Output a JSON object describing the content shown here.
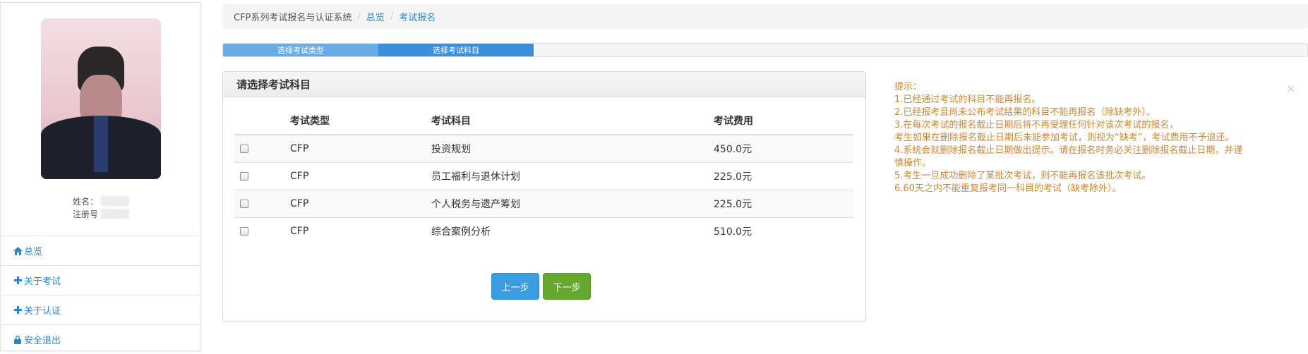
{
  "sidebar": {
    "name_label": "姓名：",
    "reg_label": "注册号",
    "nav": [
      {
        "label": "总览",
        "icon": "home-icon"
      },
      {
        "label": "关于考试",
        "icon": "plus-icon"
      },
      {
        "label": "关于认证",
        "icon": "plus-icon"
      },
      {
        "label": "安全退出",
        "icon": "lock-icon"
      }
    ]
  },
  "breadcrumb": {
    "system": "CFP系列考试报名与认证系统",
    "overview": "总览",
    "current": "考试报名",
    "separator": "/"
  },
  "steps": {
    "step1": "选择考试类型",
    "step2": "选择考试科目"
  },
  "panel": {
    "title": "请选择考试科目",
    "headers": {
      "type": "考试类型",
      "subject": "考试科目",
      "fee": "考试费用"
    },
    "rows": [
      {
        "type": "CFP",
        "subject": "投资规划",
        "fee": "450.0元"
      },
      {
        "type": "CFP",
        "subject": "员工福利与退休计划",
        "fee": "225.0元"
      },
      {
        "type": "CFP",
        "subject": "个人税务与遗产筹划",
        "fee": "225.0元"
      },
      {
        "type": "CFP",
        "subject": "综合案例分析",
        "fee": "510.0元"
      }
    ],
    "prev_label": "上一步",
    "next_label": "下一步"
  },
  "tips": {
    "close": "×",
    "title": "提示：",
    "lines": [
      "1.已经通过考试的科目不能再报名。",
      "2.已经报考且尚未公布考试结果的科目不能再报名（除缺考外）。",
      "3.在每次考试的报名截止日期后将不再受理任何针对该次考试的报名，",
      "考生如果在删除报名截止日期后未能参加考试，则视为“缺考”，考试费用不予退还。",
      "4.系统会就删除报名截止日期做出提示。请在报名时务必关注删除报名截止日期，并谨",
      "慎操作。",
      "5.考生一旦成功删除了某批次考试，则不能再报名该批次考试。",
      "6.60天之内不能重复报考同一科目的考试（缺考除外）。"
    ]
  },
  "colors": {
    "link": "#2a86c9",
    "tips": "#c6893a",
    "prev_button": "#3a9de0",
    "next_button": "#66a82e",
    "step_active": "#3c8fd9"
  }
}
